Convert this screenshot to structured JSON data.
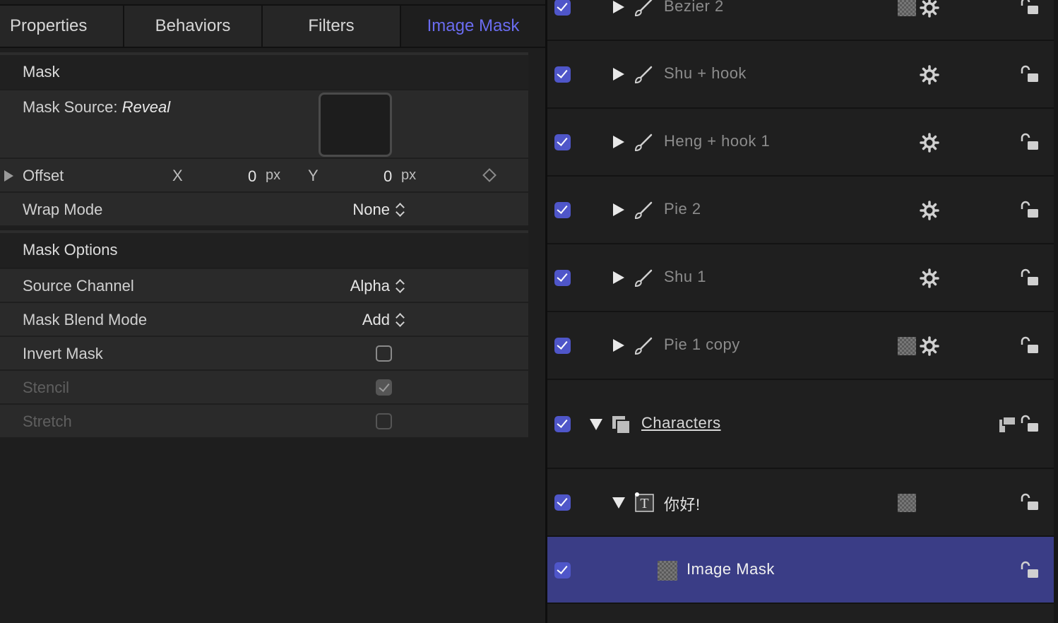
{
  "tabs": [
    "Properties",
    "Behaviors",
    "Filters",
    "Image Mask"
  ],
  "active_tab": "Image Mask",
  "mask_section": {
    "title": "Mask",
    "source_label": "Mask Source:",
    "source_value": "Reveal",
    "offset": {
      "label": "Offset",
      "x_label": "X",
      "x_value": "0",
      "x_unit": "px",
      "y_label": "Y",
      "y_value": "0",
      "y_unit": "px"
    },
    "wrap_mode": {
      "label": "Wrap Mode",
      "value": "None"
    }
  },
  "options_section": {
    "title": "Mask Options",
    "source_channel": {
      "label": "Source Channel",
      "value": "Alpha"
    },
    "blend_mode": {
      "label": "Mask Blend Mode",
      "value": "Add"
    },
    "invert_mask": {
      "label": "Invert Mask",
      "checked": false
    },
    "stencil": {
      "label": "Stencil",
      "checked": true,
      "disabled": true
    },
    "stretch": {
      "label": "Stretch",
      "checked": false,
      "disabled": true
    }
  },
  "layers": [
    {
      "name": "Bezier 2",
      "type": "shape",
      "enabled": true,
      "expanded": false,
      "has_mask_icon": true,
      "has_behavior_icon": true
    },
    {
      "name": "Shu + hook",
      "type": "shape",
      "enabled": true,
      "expanded": false,
      "has_mask_icon": false,
      "has_behavior_icon": true
    },
    {
      "name": "Heng + hook 1",
      "type": "shape",
      "enabled": true,
      "expanded": false,
      "has_mask_icon": false,
      "has_behavior_icon": true
    },
    {
      "name": "Pie 2",
      "type": "shape",
      "enabled": true,
      "expanded": false,
      "has_mask_icon": false,
      "has_behavior_icon": true
    },
    {
      "name": "Shu 1",
      "type": "shape",
      "enabled": true,
      "expanded": false,
      "has_mask_icon": false,
      "has_behavior_icon": true
    },
    {
      "name": "Pie 1 copy",
      "type": "shape",
      "enabled": true,
      "expanded": false,
      "has_mask_icon": true,
      "has_behavior_icon": true
    },
    {
      "name": "Characters",
      "type": "group",
      "enabled": true,
      "expanded": true
    },
    {
      "name": "你好!",
      "type": "text",
      "enabled": true,
      "expanded": true,
      "has_mask_icon": true
    },
    {
      "name": "Image Mask",
      "type": "mask",
      "enabled": true,
      "selected": true
    }
  ],
  "colors": {
    "accent": "#6a6cf0",
    "selection": "#3a3d86",
    "checkbox": "#4f56c9"
  }
}
